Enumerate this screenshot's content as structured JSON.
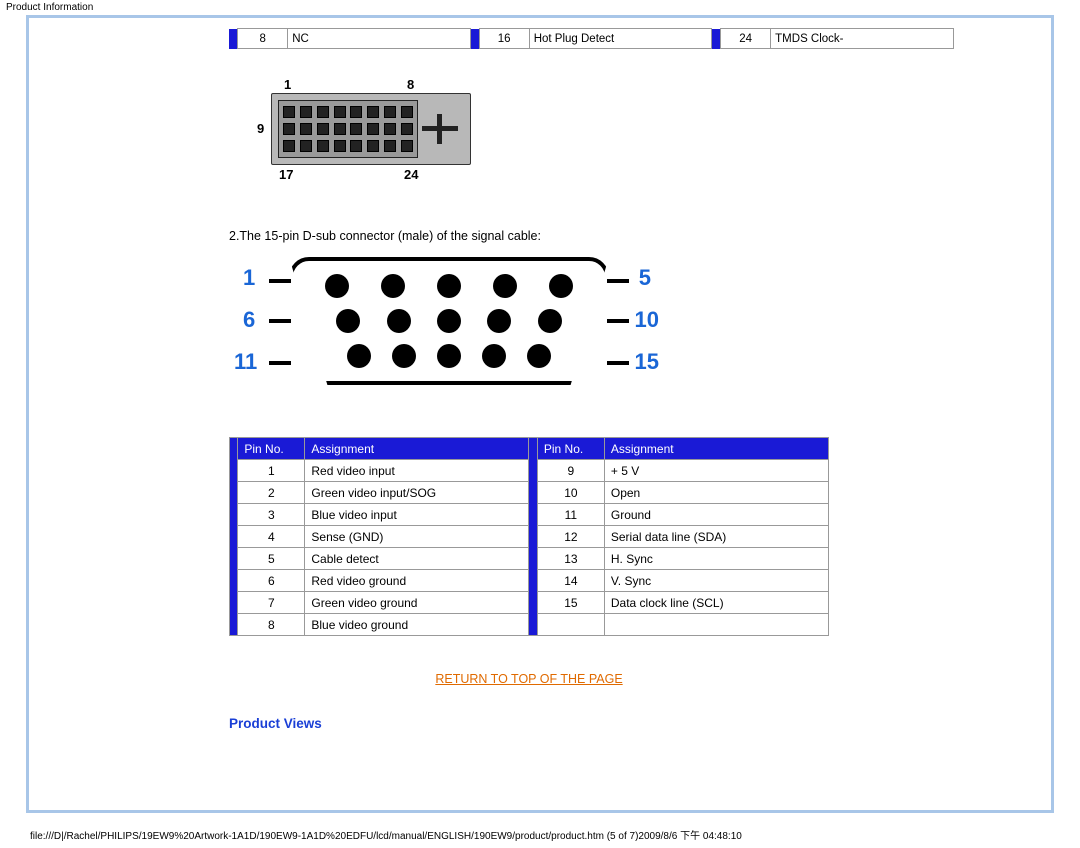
{
  "header_title": "Product Information",
  "top_row": {
    "c1_num": "8",
    "c1_txt": "NC",
    "c2_num": "16",
    "c2_txt": "Hot Plug Detect",
    "c3_num": "24",
    "c3_txt": "TMDS Clock-"
  },
  "dvi_labels": {
    "t1": "1",
    "t8": "8",
    "l9": "9",
    "b17": "17",
    "b24": "24"
  },
  "body_line": "2.The 15-pin D-sub connector (male) of the signal cable:",
  "vga_labels": {
    "n1": "1",
    "n6": "6",
    "n11": "11",
    "n5": "5",
    "n10": "10",
    "n15": "15"
  },
  "table_headers": {
    "pin": "Pin No.",
    "assign": "Assignment"
  },
  "pins_left": [
    {
      "n": "1",
      "a": "Red video input"
    },
    {
      "n": "2",
      "a": "Green video input/SOG"
    },
    {
      "n": "3",
      "a": "Blue video input"
    },
    {
      "n": "4",
      "a": "Sense (GND)"
    },
    {
      "n": "5",
      "a": "Cable detect"
    },
    {
      "n": "6",
      "a": "Red video ground"
    },
    {
      "n": "7",
      "a": "Green video ground"
    },
    {
      "n": "8",
      "a": "Blue video ground"
    }
  ],
  "pins_right": [
    {
      "n": "9",
      "a": "+ 5 V"
    },
    {
      "n": "10",
      "a": "Open"
    },
    {
      "n": "11",
      "a": "Ground"
    },
    {
      "n": "12",
      "a": "Serial data line (SDA)"
    },
    {
      "n": "13",
      "a": "H. Sync"
    },
    {
      "n": "14",
      "a": "V. Sync"
    },
    {
      "n": "15",
      "a": "Data clock line (SCL)"
    },
    {
      "n": "",
      "a": ""
    }
  ],
  "return_link": "RETURN TO TOP OF THE PAGE",
  "section_title": "Product Views",
  "footer": "file:///D|/Rachel/PHILIPS/19EW9%20Artwork-1A1D/190EW9-1A1D%20EDFU/lcd/manual/ENGLISH/190EW9/product/product.htm (5 of 7)2009/8/6 下午 04:48:10"
}
